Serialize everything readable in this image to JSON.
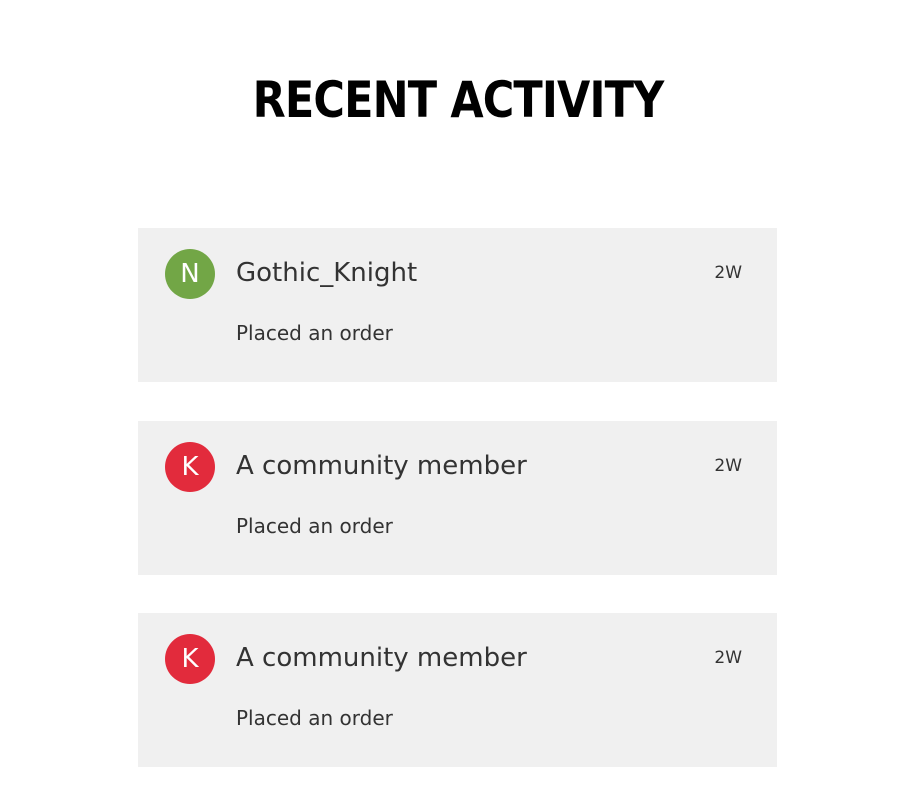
{
  "header": {
    "title": "RECENT ACTIVITY"
  },
  "activities": [
    {
      "avatar_letter": "N",
      "avatar_color": "#72a646",
      "name": "Gothic_Knight",
      "time": "2W",
      "action": "Placed an order"
    },
    {
      "avatar_letter": "K",
      "avatar_color": "#e22b3c",
      "name": "A community member",
      "time": "2W",
      "action": "Placed an order"
    },
    {
      "avatar_letter": "K",
      "avatar_color": "#e22b3c",
      "name": "A community member",
      "time": "2W",
      "action": "Placed an order"
    }
  ]
}
